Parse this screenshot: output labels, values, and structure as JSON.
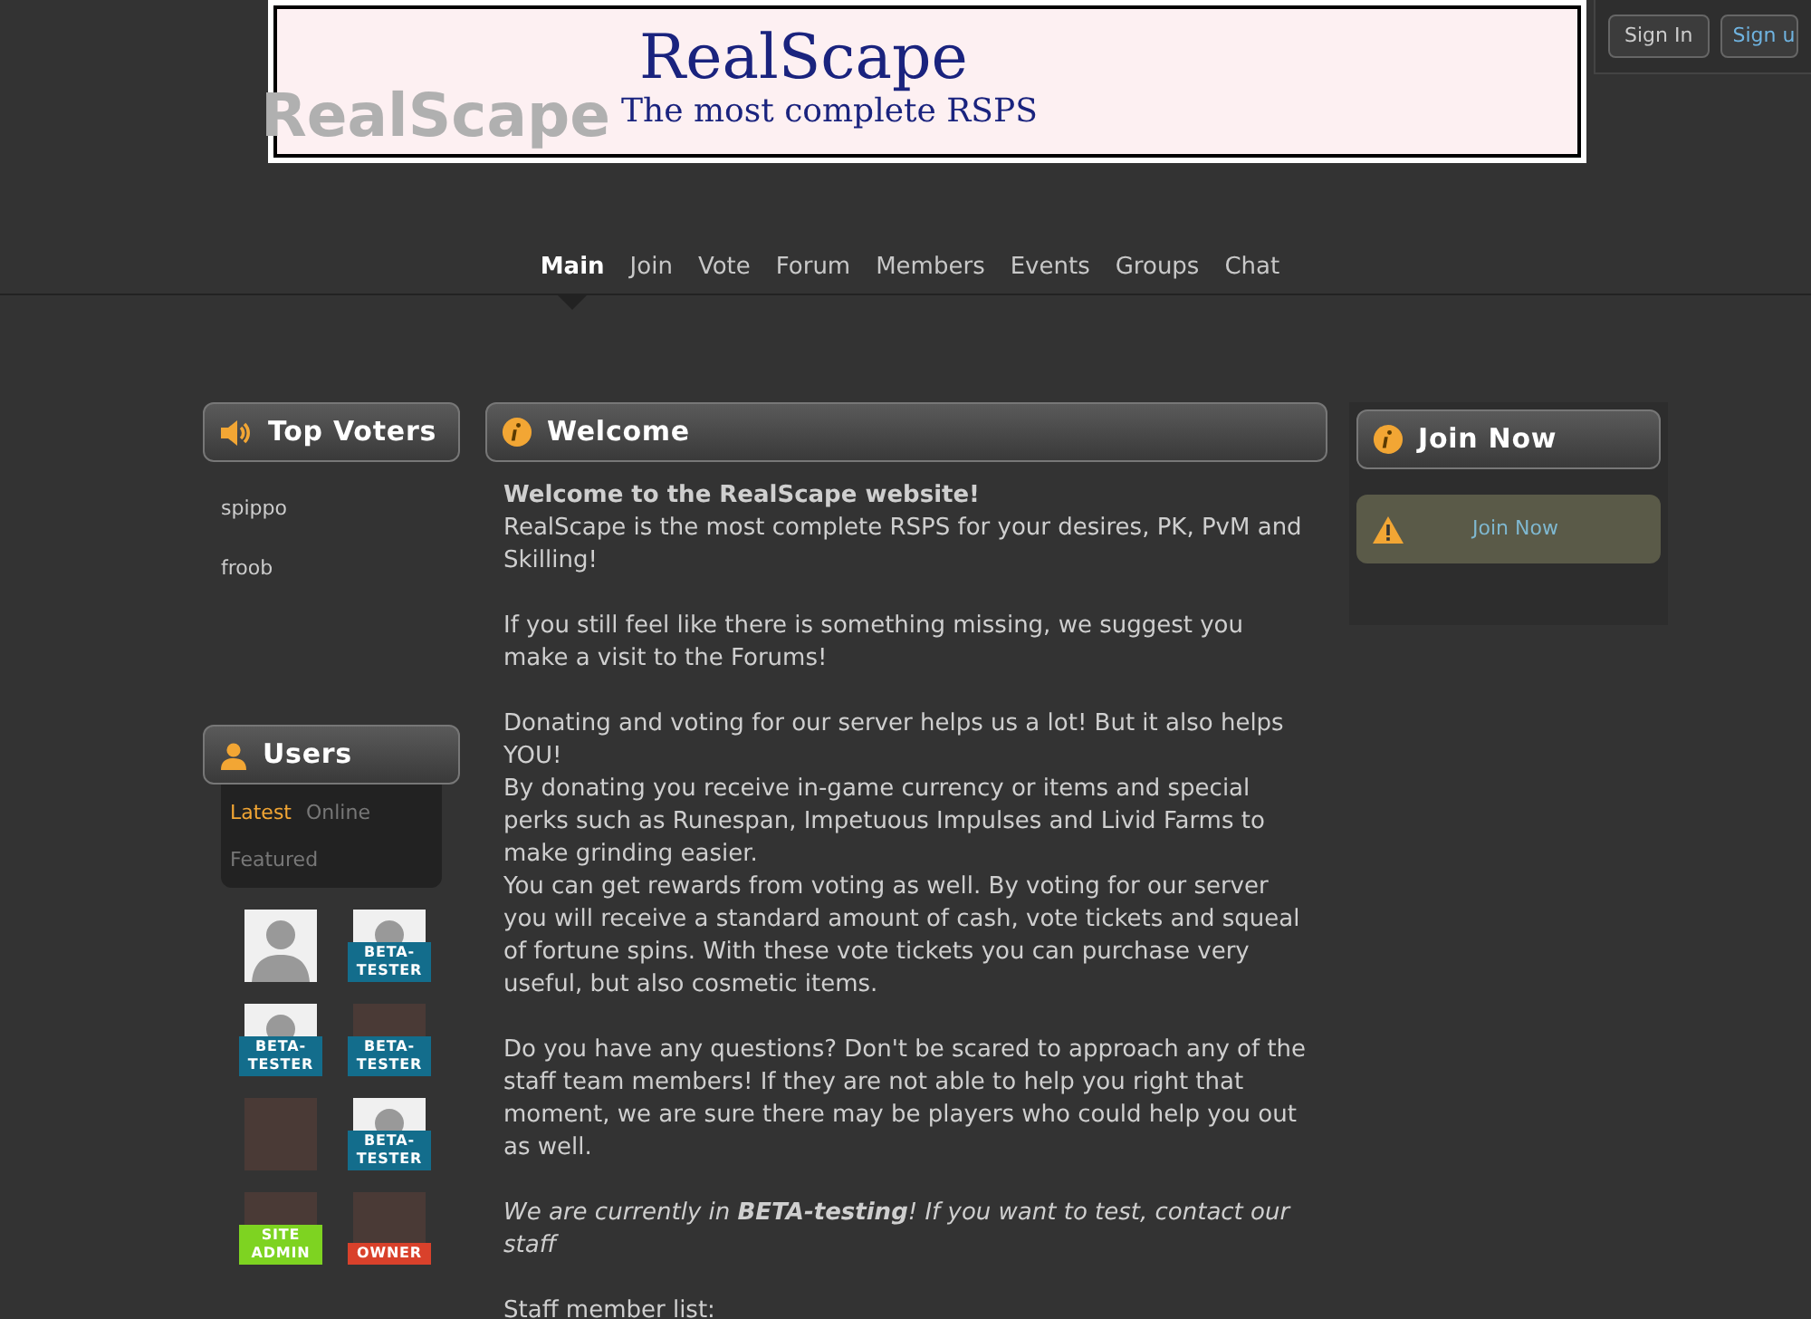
{
  "header": {
    "logo_text": "RealScape",
    "banner_title": "RealScape",
    "banner_subtitle": "The most complete RSPS",
    "buttons": [
      {
        "label": "Sign In",
        "kind": "plain"
      },
      {
        "label": "Sign u",
        "kind": "link"
      }
    ]
  },
  "nav": [
    {
      "label": "Main",
      "selected": true
    },
    {
      "label": "Join",
      "selected": false
    },
    {
      "label": "Vote",
      "selected": false
    },
    {
      "label": "Forum",
      "selected": false
    },
    {
      "label": "Members",
      "selected": false
    },
    {
      "label": "Events",
      "selected": false
    },
    {
      "label": "Groups",
      "selected": false
    },
    {
      "label": "Chat",
      "selected": false
    }
  ],
  "top_voters": {
    "title": "Top Voters",
    "items": [
      "spippo",
      "froob"
    ]
  },
  "users": {
    "title": "Users",
    "tabs": [
      {
        "label": "Latest",
        "selected": true
      },
      {
        "label": "Online",
        "selected": false
      },
      {
        "label": "Featured",
        "selected": false
      }
    ],
    "avatars": [
      {
        "kind": "default"
      },
      {
        "kind": "default",
        "badge": {
          "text": "BETA-TESTER",
          "color": "#136d8c"
        }
      },
      {
        "kind": "default",
        "badge": {
          "text": "BETA-TESTER",
          "color": "#136d8c"
        }
      },
      {
        "kind": "photo",
        "badge": {
          "text": "BETA-TESTER",
          "color": "#136d8c"
        }
      },
      {
        "kind": "photo"
      },
      {
        "kind": "default",
        "badge": {
          "text": "BETA-TESTER",
          "color": "#136d8c"
        }
      },
      {
        "kind": "photo",
        "badge": {
          "text": "SITE ADMIN",
          "color": "#7ed321"
        }
      },
      {
        "kind": "photo",
        "badge": {
          "text": "OWNER",
          "color": "#d9412b"
        }
      }
    ]
  },
  "welcome": {
    "title": "Welcome",
    "paragraphs": [
      {
        "kind": "normal",
        "text": "**Welcome to the RealScape website!**\nRealScape is the most complete RSPS for your desires, PK, PvM and Skilling!"
      },
      {
        "kind": "normal",
        "text": "If you still feel like there is something missing, we suggest you make a visit to the Forums!"
      },
      {
        "kind": "normal",
        "text": "Donating and voting for our server helps us a lot! But it also helps YOU!\nBy donating you receive in-game currency or items and special perks such as Runespan, Impetuous Impulses and Livid Farms to make grinding easier.\nYou can get rewards from voting as well. By voting for our server you will receive a standard amount of cash, vote tickets and squeal of fortune spins. With these vote tickets you can purchase very useful, but also cosmetic items."
      },
      {
        "kind": "normal",
        "text": "Do you have any questions? Don't be scared to approach any of the staff team members! If they are not able to help you right that moment, we are sure there may be players who could help you out as well."
      },
      {
        "kind": "italic",
        "text": "We are currently in **BETA-testing**! If you want to test, contact our staff"
      },
      {
        "kind": "normal",
        "text": "Staff member list:"
      }
    ]
  },
  "join": {
    "title": "Join Now",
    "link": "Join Now"
  }
}
